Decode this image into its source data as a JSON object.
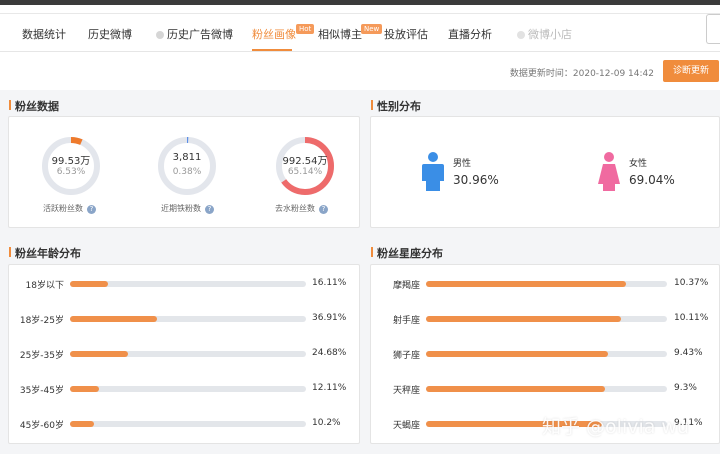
{
  "tabs": [
    {
      "label": "数据统计",
      "state": "normal"
    },
    {
      "label": "历史微博",
      "state": "normal"
    },
    {
      "label": "历史广告微博",
      "state": "dot"
    },
    {
      "label": "粉丝画像",
      "state": "active",
      "badge": "Hot"
    },
    {
      "label": "相似博主",
      "state": "normal",
      "badge": "New"
    },
    {
      "label": "投放评估",
      "state": "normal"
    },
    {
      "label": "直播分析",
      "state": "normal"
    },
    {
      "label": "微博小店",
      "state": "dim"
    }
  ],
  "update": {
    "text": "数据更新时间：2020-12-09 14:42",
    "button": "诊断更新"
  },
  "fans": {
    "title": "粉丝数据",
    "rings": [
      {
        "value": "99.53万",
        "pct": "6.53%",
        "label": "活跃粉丝数",
        "fraction": 0.0653,
        "color": "#ee7a2c"
      },
      {
        "value": "3,811",
        "pct": "0.38%",
        "label": "近期铁粉数",
        "fraction": 0.0038,
        "color": "#5b8ee6"
      },
      {
        "value": "992.54万",
        "pct": "65.14%",
        "label": "去水粉丝数",
        "fraction": 0.6514,
        "color": "#ee6b6b"
      }
    ]
  },
  "gender": {
    "title": "性别分布",
    "male_label": "男性",
    "male_value": "30.96%",
    "female_label": "女性",
    "female_value": "69.04%",
    "male_color": "#3a8ee6",
    "female_color": "#f06aa0"
  },
  "age": {
    "title": "粉丝年龄分布",
    "rows": [
      {
        "label": "18岁以下",
        "value": "16.11%",
        "pct": 16.11
      },
      {
        "label": "18岁-25岁",
        "value": "36.91%",
        "pct": 36.91
      },
      {
        "label": "25岁-35岁",
        "value": "24.68%",
        "pct": 24.68
      },
      {
        "label": "35岁-45岁",
        "value": "12.11%",
        "pct": 12.11
      },
      {
        "label": "45岁-60岁",
        "value": "10.2%",
        "pct": 10.2
      }
    ]
  },
  "zodiac": {
    "title": "粉丝星座分布",
    "rows": [
      {
        "label": "摩羯座",
        "value": "10.37%",
        "pct": 10.37
      },
      {
        "label": "射手座",
        "value": "10.11%",
        "pct": 10.11
      },
      {
        "label": "狮子座",
        "value": "9.43%",
        "pct": 9.43
      },
      {
        "label": "天秤座",
        "value": "9.3%",
        "pct": 9.3
      },
      {
        "label": "天蝎座",
        "value": "9.11%",
        "pct": 9.11
      }
    ]
  },
  "watermark": "知乎 @olivia wu"
}
